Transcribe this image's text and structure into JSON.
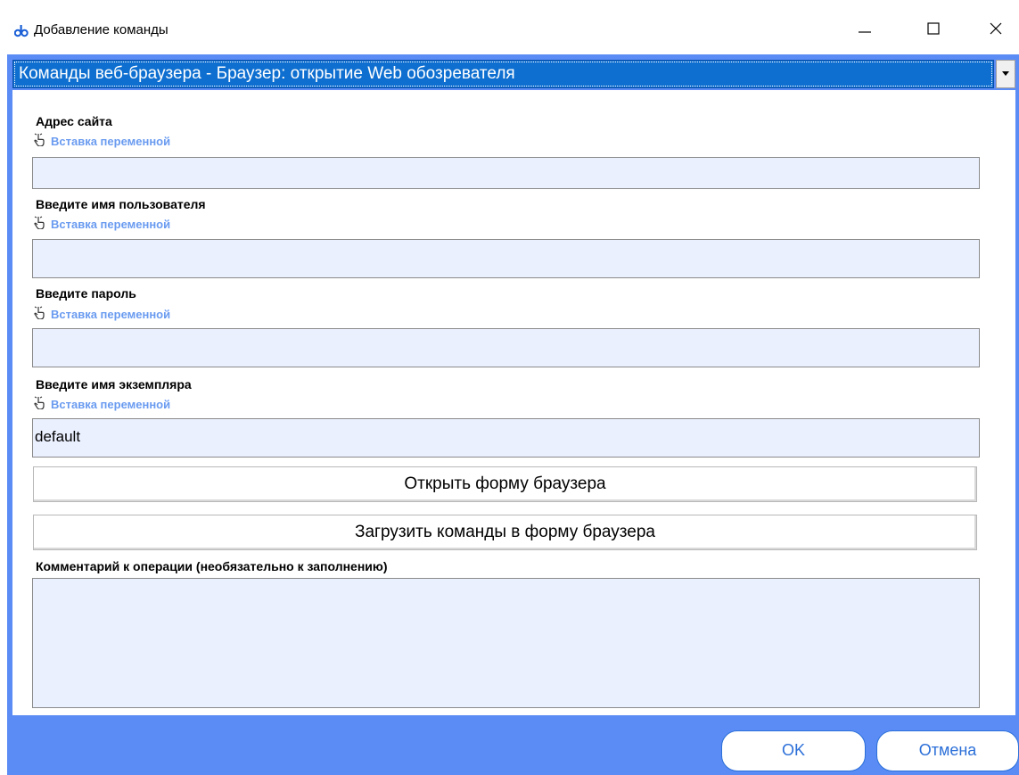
{
  "window": {
    "title": "Добавление команды",
    "icon": "app-icon",
    "controls": {
      "minimize": "minimize-icon",
      "maximize": "maximize-icon",
      "close": "close-icon"
    }
  },
  "command_selector": {
    "value": "Команды веб-браузера - Браузер: открытие Web обозревателя",
    "icon": "dropdown-arrow-icon"
  },
  "fields": [
    {
      "label": "Адрес сайта",
      "insert_link": "Вставка переменной",
      "value": ""
    },
    {
      "label": "Введите имя пользователя",
      "insert_link": "Вставка переменной",
      "value": ""
    },
    {
      "label": "Введите пароль",
      "insert_link": "Вставка переменной",
      "value": ""
    },
    {
      "label": "Введите имя экземпляра",
      "insert_link": "Вставка переменной",
      "value": "default"
    }
  ],
  "buttons": {
    "open_browser_form": "Открыть форму браузера",
    "load_commands": "Загрузить команды в форму браузера",
    "ok": "OK",
    "cancel": "Отмена"
  },
  "comment": {
    "label": "Комментарий к операции (необязательно к заполнению)",
    "value": ""
  },
  "colors": {
    "frame_blue": "#5b8cf5",
    "selector_blue": "#0e6fd0",
    "field_bg": "#ebf0ff",
    "link_blue": "#6a9bf0",
    "button_text_blue": "#2b6fd8"
  }
}
